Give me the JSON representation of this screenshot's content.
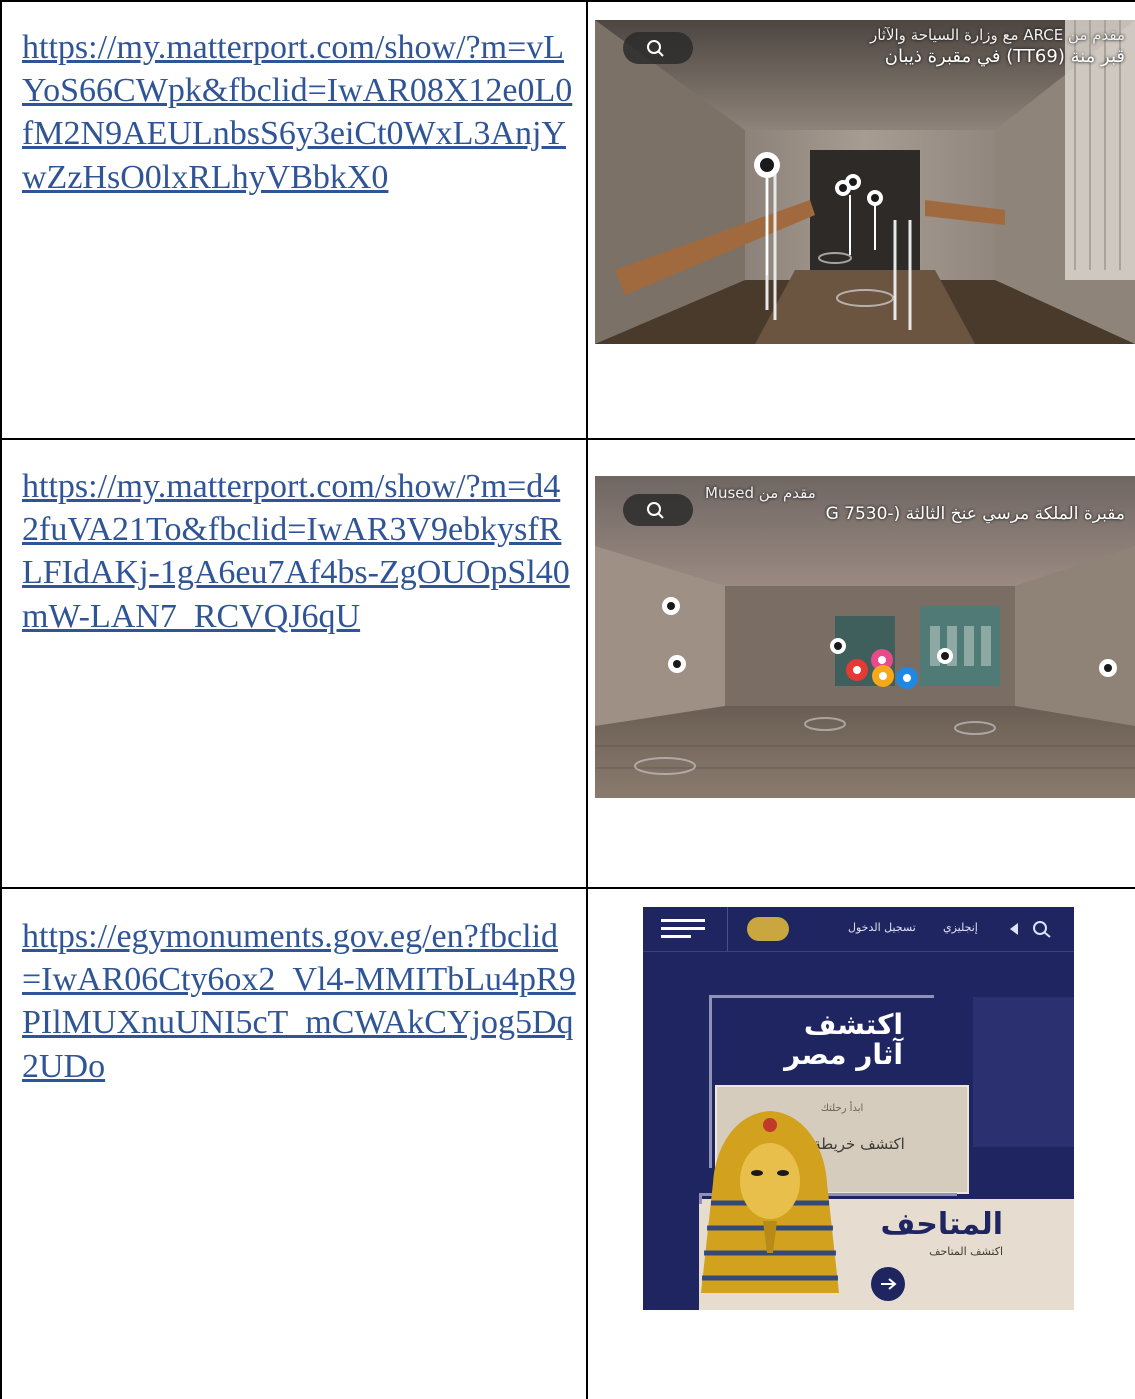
{
  "rows": [
    {
      "link": "https://my.matterport.com/show/?m=vLYoS66CWpk&fbclid=IwAR08X12e0L0fM2N9AEULnbsS6y3eiCt0WxL3AnjYwZzHsO0lxRLhyVBbkX0",
      "image": {
        "caption_top": "مع وزارة السياحة والآثار ARCE مقدم من",
        "caption_bottom": "في مقبرة ذيبان (TT69) قبر منة"
      }
    },
    {
      "link": "https://my.matterport.com/show/?m=d42fuVA21To&fbclid=IwAR3V9ebkysfRLFIdAKj-1gA6eu7Af4bs-ZgOUOpSl40mW-LAN7_RCVQJ6qU",
      "image": {
        "caption_top": "Mused مقدم من",
        "caption_bottom": "G 7530-) مقبرة الملكة مرسي عنخ الثالثة"
      }
    },
    {
      "link": "https://egymonuments.gov.eg/en?fbclid=IwAR06Cty6ox2_Vl4-MMITbLu4pR9PIlMUXnuUNI5cT_mCWAkCYjog5Dq2UDo",
      "image": {
        "nav_login": "تسجيل الدخول",
        "nav_lang": "إنجليزي",
        "hero_line1": "اكتشف",
        "hero_line2": "آثار مصر",
        "card_small": "ابدأ رحلتك",
        "card_main": "اكتشف خريطة مصر",
        "museums_title": "المتاحف",
        "museums_sub": "اكتشف المتاحف"
      }
    }
  ],
  "colors": {
    "link": "#2f5597",
    "rule": "#000000",
    "site_navy": "#1f2560"
  }
}
